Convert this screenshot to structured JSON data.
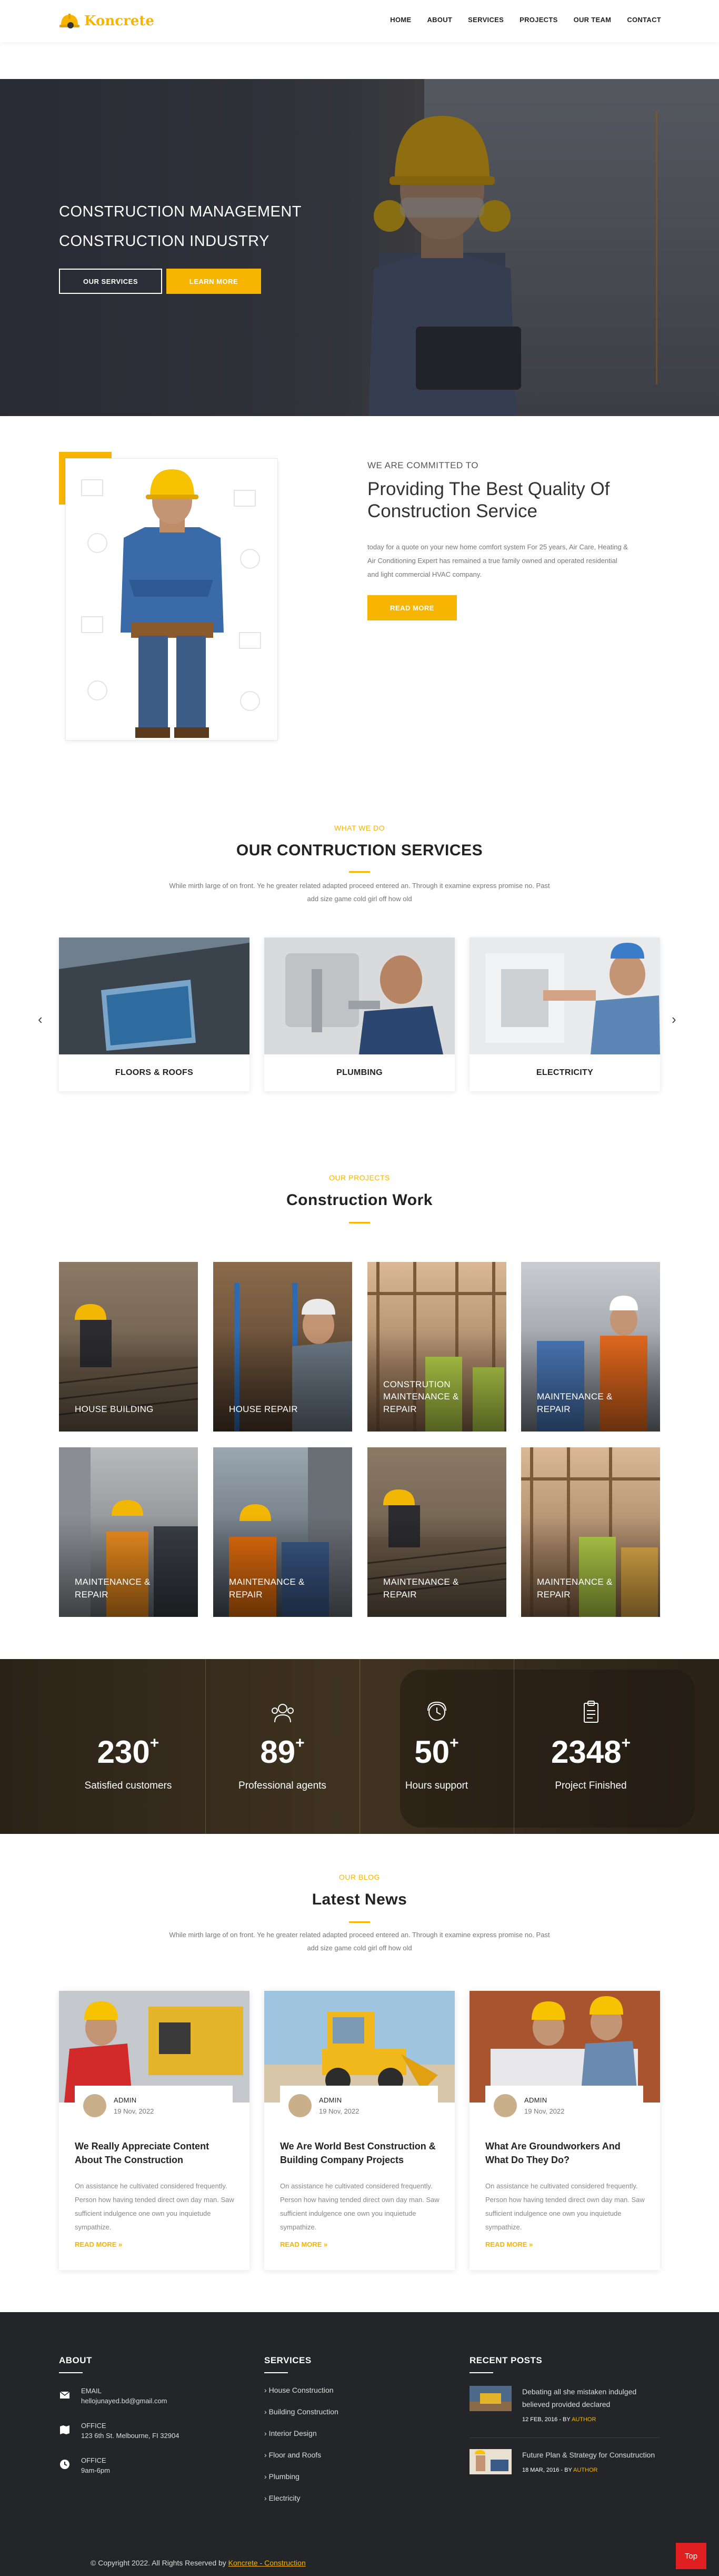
{
  "brand": {
    "name": "Koncrete",
    "accent": "#f7b500"
  },
  "nav": [
    "HOME",
    "ABOUT",
    "SERVICES",
    "PROJECTS",
    "OUR TEAM",
    "CONTACT"
  ],
  "hero": {
    "line1": "CONSTRUCTION MANAGEMENT",
    "line2": "CONSTRUCTION INDUSTRY",
    "btn_services": "OUR SERVICES",
    "btn_learn": "LEARN MORE"
  },
  "about": {
    "kicker": "WE ARE COMMITTED TO",
    "title": "Providing The Best Quality Of Construction Service",
    "text": "today for a quote on your new home comfort system For 25 years, Air Care, Heating & Air Conditioning Expert has remained a true family owned and operated residential and light commercial HVAC company.",
    "btn": "READ MORE"
  },
  "services": {
    "kicker": "WHAT WE DO",
    "title": "OUR CONTRUCTION SERVICES",
    "desc": "While mirth large of on front. Ye he greater related adapted proceed entered an. Through it examine express promise no. Past add size game cold girl off how old",
    "items": [
      "FLOORS & ROOFS",
      "PLUMBING",
      "ELECTRICITY"
    ],
    "prev": "‹",
    "next": "›"
  },
  "projects": {
    "kicker": "OUR PROJECTS",
    "title": "Construction Work",
    "items": [
      "HOUSE BUILDING",
      "HOUSE REPAIR",
      "CONSTRUTION MAINTENANCE & REPAIR",
      "MAINTENANCE & REPAIR",
      "MAINTENANCE & REPAIR",
      "MAINTENANCE & REPAIR",
      "MAINTENANCE & REPAIR",
      "MAINTENANCE & REPAIR"
    ]
  },
  "counters": [
    {
      "num": "230",
      "sup": "+",
      "label": "Satisfied customers"
    },
    {
      "num": "89",
      "sup": "+",
      "label": "Professional agents"
    },
    {
      "num": "50",
      "sup": "+",
      "label": "Hours support"
    },
    {
      "num": "2348",
      "sup": "+",
      "label": "Project Finished"
    }
  ],
  "blog": {
    "kicker": "OUR BLOG",
    "title": "Latest News",
    "desc": "While mirth large of on front. Ye he greater related adapted proceed entered an. Through it examine express promise no. Past add size game cold girl off how old",
    "posts": [
      {
        "author": "ADMIN",
        "date": "19 Nov, 2022",
        "title": "We Really Appreciate Content About The Construction",
        "text": "On assistance he cultivated considered frequently. Person how having tended direct own day man. Saw sufficient indulgence one own you inquietude sympathize.",
        "more": "READ MORE  »"
      },
      {
        "author": "ADMIN",
        "date": "19 Nov, 2022",
        "title": "We Are World Best Construction & Building Company Projects",
        "text": "On assistance he cultivated considered frequently. Person how having tended direct own day man. Saw sufficient indulgence one own you inquietude sympathize.",
        "more": "READ MORE  »"
      },
      {
        "author": "ADMIN",
        "date": "19 Nov, 2022",
        "title": "What Are Groundworkers And What Do They Do?",
        "text": "On assistance he cultivated considered frequently. Person how having tended direct own day man. Saw sufficient indulgence one own you inquietude sympathize.",
        "more": "READ MORE  »"
      }
    ]
  },
  "footer": {
    "about_head": "ABOUT",
    "info": [
      {
        "label": "EMAIL",
        "value": "hellojunayed.bd@gmail.com",
        "icon": "envelope-icon"
      },
      {
        "label": "OFFICE",
        "value": "123 6th St. Melbourne, FI 32904",
        "icon": "map-icon"
      },
      {
        "label": "OFFICE",
        "value": "9am-6pm",
        "icon": "clock-icon"
      }
    ],
    "services_head": "SERVICES",
    "services": [
      "House Construction",
      "Building Construction",
      "Interior Design",
      "Floor and Roofs",
      "Plumbing",
      "Electricity"
    ],
    "posts_head": "RECENT POSTS",
    "posts": [
      {
        "title": "Debating all she mistaken indulged believed provided declared",
        "date": "12 FEB, 2016",
        "by": " - BY ",
        "author": "AUTHOR"
      },
      {
        "title": "Future Plan & Strategy for Consutruction",
        "date": "18 MAR, 2016",
        "by": " - BY ",
        "author": "AUTHOR"
      }
    ],
    "copyright_prefix": "© Copyright 2022. All Rights Reserved by ",
    "copyright_link": "Koncrete - Construction",
    "top": "Top"
  }
}
